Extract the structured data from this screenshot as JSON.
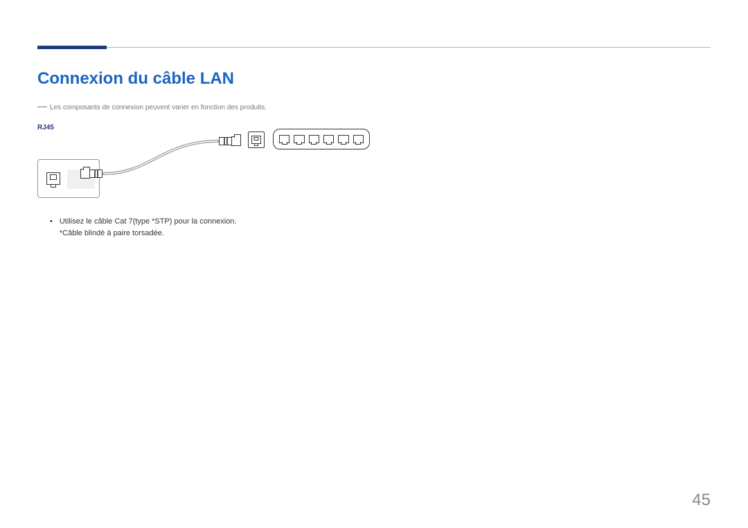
{
  "section": {
    "title": "Connexion du câble LAN",
    "note": "Les composants de connexion peuvent varier en fonction des produits.",
    "port_label": "RJ45",
    "bullet_line1": "Utilisez le câble Cat 7(type *STP) pour la connexion.",
    "bullet_line2": "*Câble blindé à paire torsadée."
  },
  "icons": {
    "rj45_port": "rj45-port-icon",
    "ethernet_plug": "ethernet-plug-icon",
    "modem": "modem-icon",
    "network_switch": "network-switch-icon",
    "cable": "ethernet-cable-icon"
  },
  "page_number": "45",
  "colors": {
    "accent_bar": "#1e3a7b",
    "title": "#1b64c2",
    "rule": "#b0b0b0",
    "device_outline": "#8f9f5a"
  }
}
